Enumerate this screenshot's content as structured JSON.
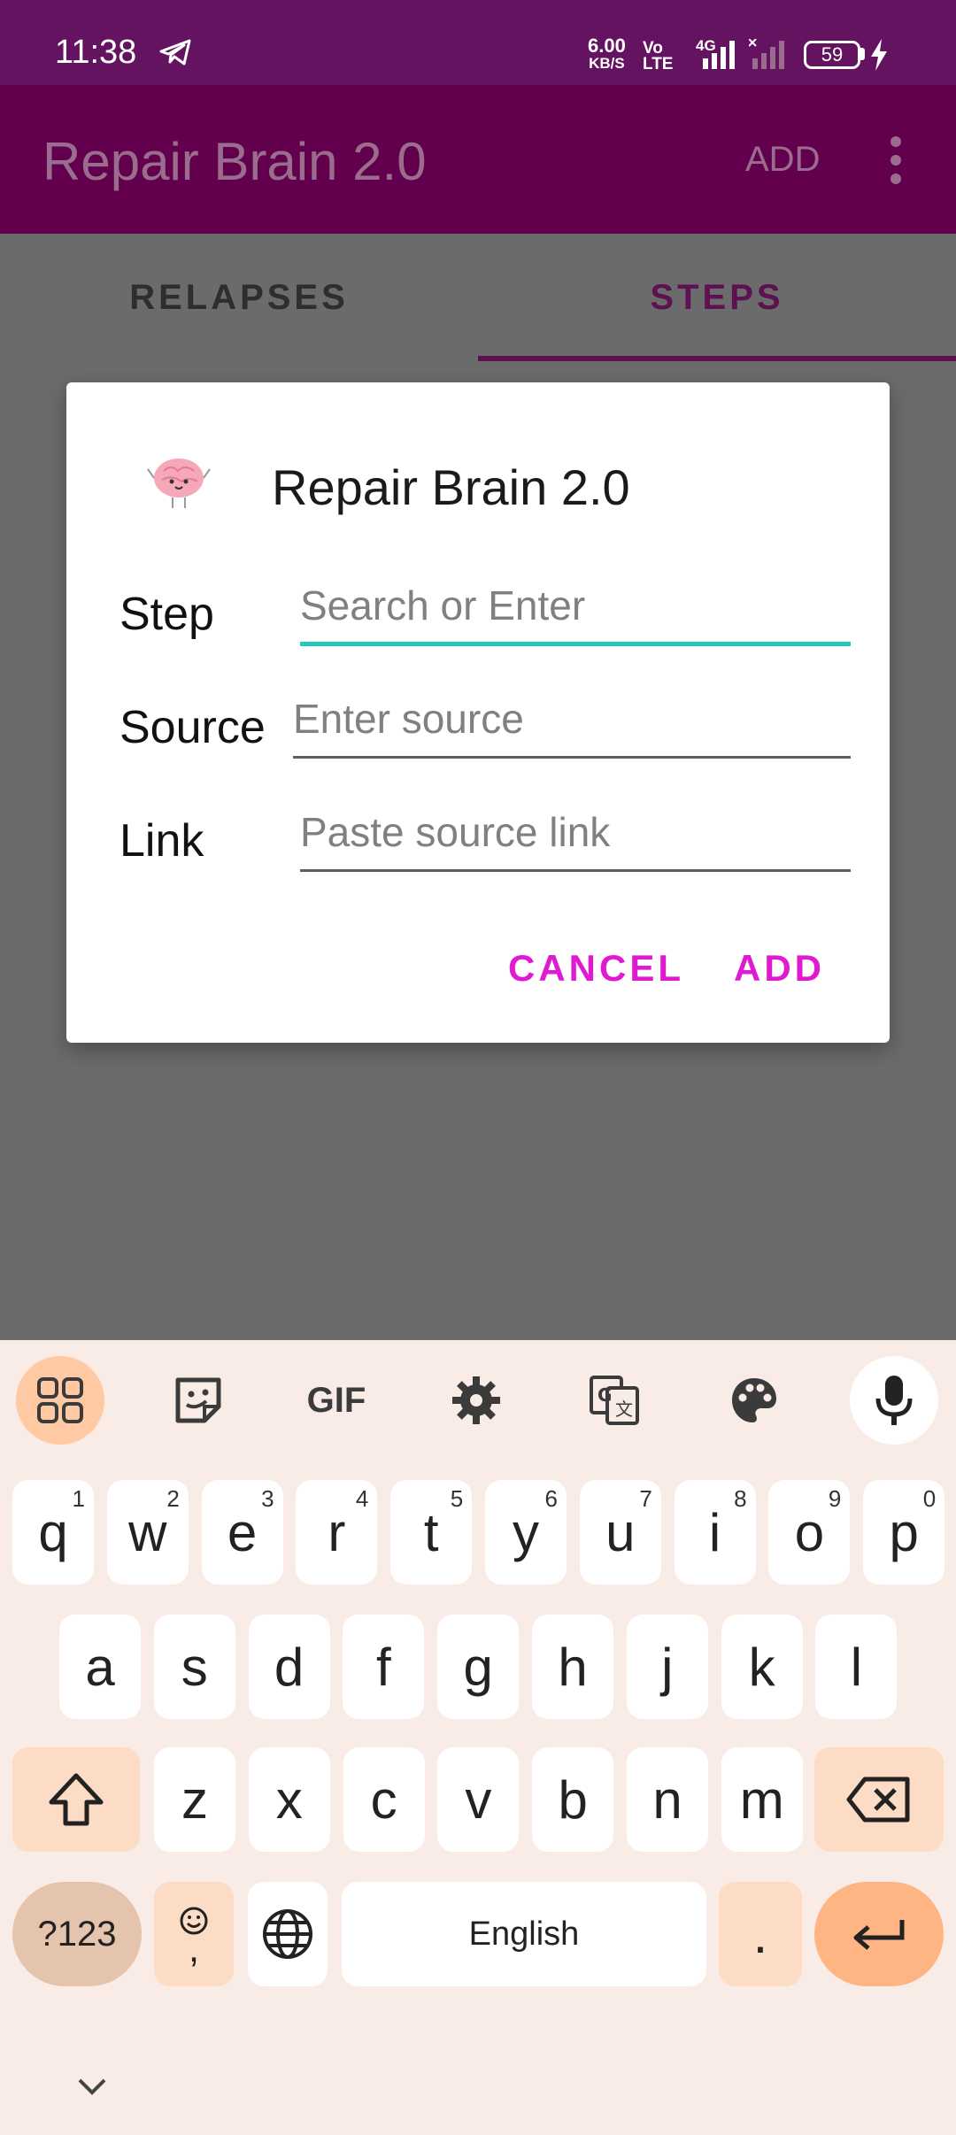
{
  "status_bar": {
    "time": "11:38",
    "net_speed_value": "6.00",
    "net_speed_unit": "KB/S",
    "volte_top": "Vo",
    "volte_bottom": "LTE",
    "network_type": "4G",
    "battery_level": "59"
  },
  "app_bar": {
    "title": "Repair Brain 2.0",
    "add_label": "ADD"
  },
  "tabs": [
    {
      "label": "RELAPSES",
      "selected": false
    },
    {
      "label": "STEPS",
      "selected": true
    }
  ],
  "dialog": {
    "title": "Repair Brain 2.0",
    "fields": {
      "step": {
        "label": "Step",
        "placeholder": "Search or Enter",
        "value": ""
      },
      "source": {
        "label": "Source",
        "placeholder": "Enter source",
        "value": ""
      },
      "link": {
        "label": "Link",
        "placeholder": "Paste source link",
        "value": ""
      }
    },
    "cancel_label": "CANCEL",
    "add_label": "ADD"
  },
  "keyboard": {
    "toolbar": {
      "gif_label": "GIF"
    },
    "row1": [
      {
        "key": "q",
        "hint": "1"
      },
      {
        "key": "w",
        "hint": "2"
      },
      {
        "key": "e",
        "hint": "3"
      },
      {
        "key": "r",
        "hint": "4"
      },
      {
        "key": "t",
        "hint": "5"
      },
      {
        "key": "y",
        "hint": "6"
      },
      {
        "key": "u",
        "hint": "7"
      },
      {
        "key": "i",
        "hint": "8"
      },
      {
        "key": "o",
        "hint": "9"
      },
      {
        "key": "p",
        "hint": "0"
      }
    ],
    "row2": [
      "a",
      "s",
      "d",
      "f",
      "g",
      "h",
      "j",
      "k",
      "l"
    ],
    "row3": [
      "z",
      "x",
      "c",
      "v",
      "b",
      "n",
      "m"
    ],
    "numsym_label": "?123",
    "emoji_comma_label": ",",
    "space_label": "English",
    "period_label": "."
  },
  "colors": {
    "status_bar": "#63135f",
    "app_bar_dimmed": "#62004e",
    "accent_button": "#e01ad0",
    "focus_underline": "#22c9bb"
  }
}
